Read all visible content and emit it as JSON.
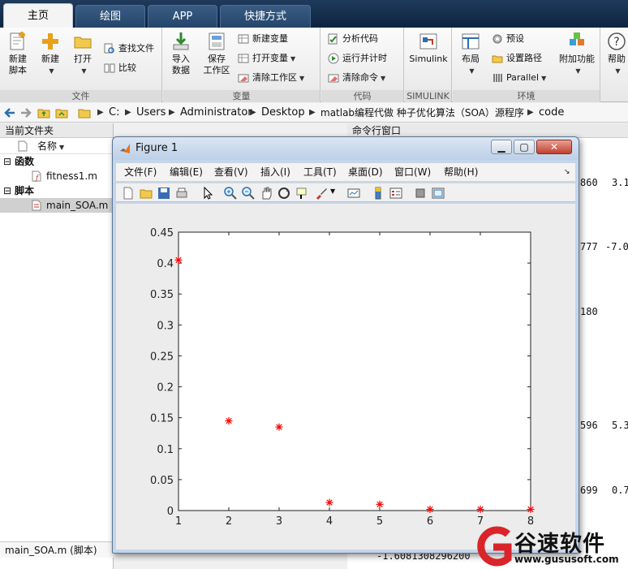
{
  "tabs": [
    {
      "label": "主页",
      "active": true
    },
    {
      "label": "绘图",
      "active": false
    },
    {
      "label": "APP",
      "active": false
    },
    {
      "label": "快捷方式",
      "active": false
    }
  ],
  "ribbon": {
    "file": {
      "label": "文件",
      "new_script_line1": "新建",
      "new_script_line2": "脚本",
      "new": "新建",
      "open": "打开",
      "find_files": "查找文件",
      "compare": "比较"
    },
    "variable": {
      "label": "变量",
      "import_line1": "导入",
      "import_line2": "数据",
      "save_ws_line1": "保存",
      "save_ws_line2": "工作区",
      "new_var": "新建变量",
      "open_var": "打开变量",
      "clear_ws": "清除工作区"
    },
    "code": {
      "label": "代码",
      "analyze": "分析代码",
      "run_time": "运行并计时",
      "clear_cmd": "清除命令"
    },
    "simulink": {
      "label": "SIMULINK",
      "button": "Simulink"
    },
    "environment": {
      "label": "环境",
      "layout": "布局",
      "preferences": "预设",
      "set_path": "设置路径",
      "parallel": "Parallel",
      "addons": "附加功能",
      "help": "帮助"
    }
  },
  "address": {
    "crumbs": [
      "C:",
      "Users",
      "Administrator",
      "Desktop",
      "matlab编程代做 种子优化算法（SOA）源程序",
      "code"
    ]
  },
  "left_panel": {
    "title": "当前文件夹",
    "column": "名称",
    "groups": [
      {
        "label": "函数",
        "items": [
          "fitness1.m"
        ]
      },
      {
        "label": "脚本",
        "items": [
          "main_SOA.m"
        ]
      }
    ],
    "footer": "main_SOA.m  (脚本)"
  },
  "right_panel": {
    "title": "命令行窗口",
    "lines": [
      {
        "a": "860",
        "b": "3.1"
      },
      {
        "a": "777",
        "b": "-7.0"
      },
      {
        "a": "180",
        "b": ""
      },
      {
        "a": "596",
        "b": "5.3"
      },
      {
        "a": "699",
        "b": "0.7"
      }
    ],
    "bottom_line": "-1.6081308296200"
  },
  "figure": {
    "title": "Figure 1",
    "menu": [
      "文件(F)",
      "编辑(E)",
      "查看(V)",
      "插入(I)",
      "工具(T)",
      "桌面(D)",
      "窗口(W)",
      "帮助(H)"
    ]
  },
  "chart_data": {
    "type": "scatter",
    "marker": "*",
    "color": "#ff0000",
    "x": [
      1,
      2,
      3,
      4,
      5,
      6,
      7,
      8
    ],
    "y": [
      0.405,
      0.145,
      0.135,
      0.013,
      0.01,
      0.002,
      0.002,
      0.002
    ],
    "xlim": [
      1,
      8
    ],
    "ylim": [
      0,
      0.45
    ],
    "xticks": [
      1,
      2,
      3,
      4,
      5,
      6,
      7,
      8
    ],
    "yticks": [
      "0",
      "0.05",
      "0.1",
      "0.15",
      "0.2",
      "0.25",
      "0.3",
      "0.35",
      "0.4",
      "0.45"
    ],
    "grid": false
  },
  "watermark": {
    "brand": "谷速软件",
    "url": "www.gususoft.com"
  }
}
